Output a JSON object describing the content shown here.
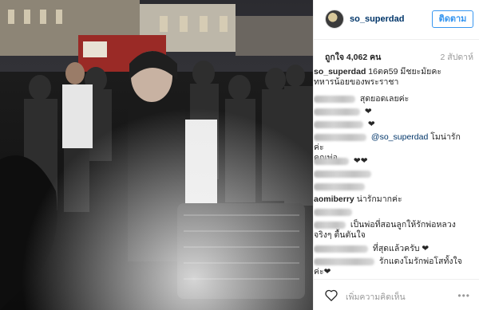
{
  "post": {
    "username": "so_superdad",
    "follow_label": "ติดตาม",
    "likes": "ถูกใจ 4,062 คน",
    "time": "2 สัปดาห์",
    "add_comment_placeholder": "เพิ่มความคิดเห็น",
    "more_glyph": "•••"
  },
  "icons": {
    "avatar": "avatar-image",
    "heart": "heart-outline-icon",
    "more": "more-options-icon"
  },
  "caption": {
    "author": "so_superdad",
    "text": "16ตค59 มีชยะมั้ยคะ",
    "text_line2": "ทหารน้อยของพระราชา"
  },
  "comments": [
    {
      "author": "",
      "text": "สุดยอดเลยค่ะ"
    },
    {
      "author": "",
      "text": "❤"
    },
    {
      "author": "",
      "text": "❤"
    },
    {
      "author": "",
      "mention": "@so_superdad",
      "text": "โมน่ารักค่ะ",
      "text_line2": "คุณพ่อ"
    },
    {
      "author": "",
      "text": "❤❤"
    },
    {
      "author": "aomiberry",
      "text": "น่ารักมากค่ะ"
    },
    {
      "author": "",
      "text": "เป็นพ่อที่สอนลูกให้รักพ่อหลวง",
      "text_line2": "จริงๆ ตื้นตันใจ"
    },
    {
      "author": "",
      "text": "ที่สุดแล้วครับ ❤"
    },
    {
      "author": "",
      "text": "รักแดงโมรักพ่อโสทั้งใจ",
      "text_line2": "ค่ะ❤"
    }
  ],
  "colors": {
    "follow_blue": "#3897f0",
    "link": "#003569",
    "muted": "#999999"
  }
}
